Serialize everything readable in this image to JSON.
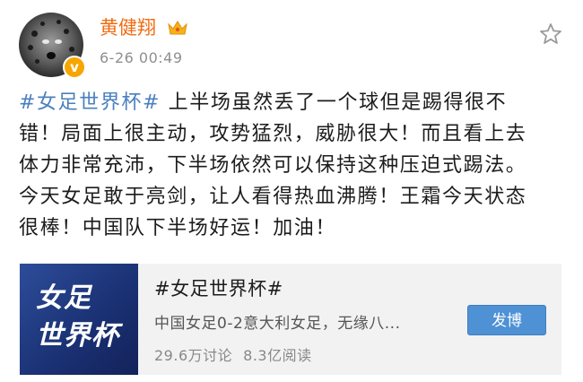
{
  "post": {
    "author": "黄健翔",
    "timestamp": "6-26 00:49",
    "hashtag": "#女足世界杯#",
    "lines": [
      " 上半场虽然丢了一个球但是踢得很不",
      "错！局面上很主动，攻势猛烈，威胁很大！而且看上去",
      "体力非常充沛，下半场依然可以保持这种压迫式踢法。",
      "今天女足敢于亮剑，让人看得热血沸腾！王霜今天状态",
      "很棒！中国队下半场好运！加油！"
    ]
  },
  "topic_card": {
    "thumb_line1": "女足",
    "thumb_line2": "世界杯",
    "title": "#女足世界杯#",
    "description": "中国女足0-2意大利女足，无缘八...",
    "discussions": "29.6万讨论",
    "reads": "8.3亿阅读",
    "button_label": "发博"
  },
  "icons": {
    "avatar": "cheetah-avatar",
    "verified": "verified-badge-icon",
    "crown": "vip-crown-icon",
    "favorite": "star-icon"
  },
  "colors": {
    "username": "#f26b11",
    "hashtag": "#4b7fbf",
    "button": "#4e91d4",
    "card_bg": "#f2f2f2"
  }
}
